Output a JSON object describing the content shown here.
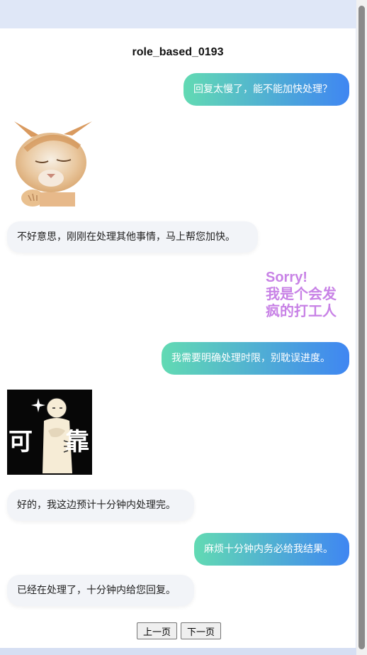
{
  "title": "role_based_0193",
  "messages": [
    {
      "role": "user",
      "text": "回复太慢了，能不能加快处理？"
    },
    {
      "role": "bot_sticker",
      "sticker": "cat-sticker"
    },
    {
      "role": "bot",
      "text": "不好意思，刚刚在处理其他事情，马上帮您加快。"
    },
    {
      "role": "user_sticker",
      "text_lines": [
        "Sorry!",
        "我是个会发",
        "疯的打工人"
      ]
    },
    {
      "role": "user",
      "text": "我需要明确处理时限，别耽误进度。"
    },
    {
      "role": "bot_sticker",
      "sticker": "reliable-sticker",
      "caption_left": "可",
      "caption_right": "靠"
    },
    {
      "role": "bot",
      "text": "好的，我这边预计十分钟内处理完。"
    },
    {
      "role": "user",
      "text": "麻烦十分钟内务必给我结果。"
    },
    {
      "role": "bot",
      "text": "已经在处理了，十分钟内给您回复。"
    }
  ],
  "pagination": {
    "prev": "上一页",
    "next": "下一页"
  },
  "colors": {
    "user_gradient_start": "#62dab3",
    "user_gradient_end": "#3f86f2",
    "sorry_text": "#c882e6"
  }
}
